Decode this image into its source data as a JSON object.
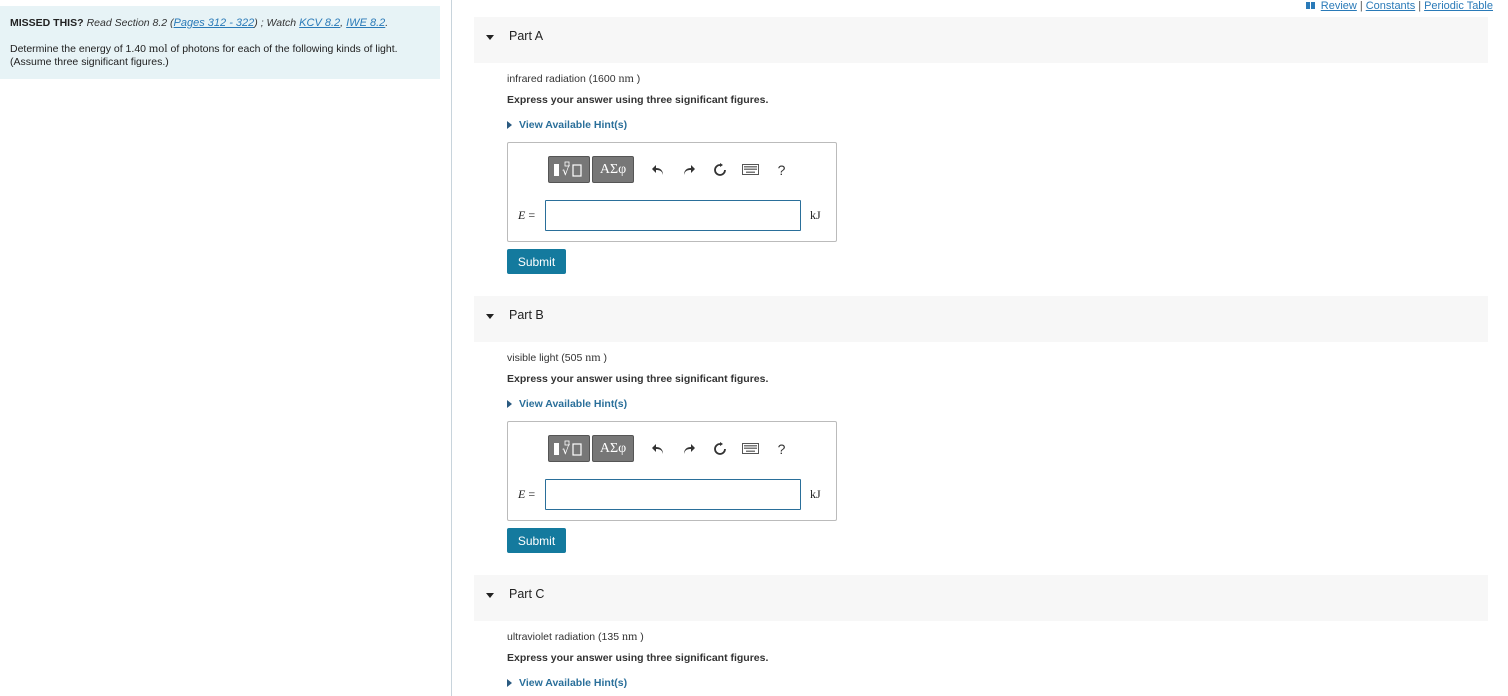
{
  "intro": {
    "missed_label": "MISSED THIS?",
    "read_text": "Read Section 8.2 (",
    "pages_link": "Pages 312 - 322",
    "watch_text": ") ; Watch",
    "kcv_link": "KCV 8.2",
    "comma": ",",
    "iwe_link": "IWE 8.2",
    "period": ".",
    "question_pre": "Determine the energy of 1.40",
    "question_unit": "mol",
    "question_post": "of photons for each of the following kinds of light.",
    "question_note": "(Assume three significant figures.)"
  },
  "toplinks": {
    "review": "Review",
    "constants": "Constants",
    "periodic_table": "Periodic Table",
    "sep": "|"
  },
  "parts": [
    {
      "title": "Part A",
      "prompt_pre": "infrared radiation (1600",
      "prompt_unit": "nm",
      "prompt_post": ")",
      "express": "Express your answer using three significant figures.",
      "hint": "View Available Hint(s)",
      "var_label": "E",
      "eq": "=",
      "unit": "kJ",
      "value": "",
      "submit": "Submit"
    },
    {
      "title": "Part B",
      "prompt_pre": "visible light (505",
      "prompt_unit": "nm",
      "prompt_post": ")",
      "express": "Express your answer using three significant figures.",
      "hint": "View Available Hint(s)",
      "var_label": "E",
      "eq": "=",
      "unit": "kJ",
      "value": "",
      "submit": "Submit"
    },
    {
      "title": "Part C",
      "prompt_pre": "ultraviolet radiation (135",
      "prompt_unit": "nm",
      "prompt_post": ")",
      "express": "Express your answer using three significant figures.",
      "hint": "View Available Hint(s)"
    }
  ],
  "toolbar": {
    "greek_label": "ΑΣφ",
    "help_label": "?",
    "icons": [
      "templates-icon",
      "greek-symbols-icon",
      "undo-icon",
      "redo-icon",
      "reset-icon",
      "keyboard-icon",
      "help-icon"
    ]
  },
  "colors": {
    "intro_bg": "#e7f3f6",
    "link": "#2a7ab8",
    "submit_bg": "#147a9e",
    "part_header_bg": "#f7f7f7"
  }
}
